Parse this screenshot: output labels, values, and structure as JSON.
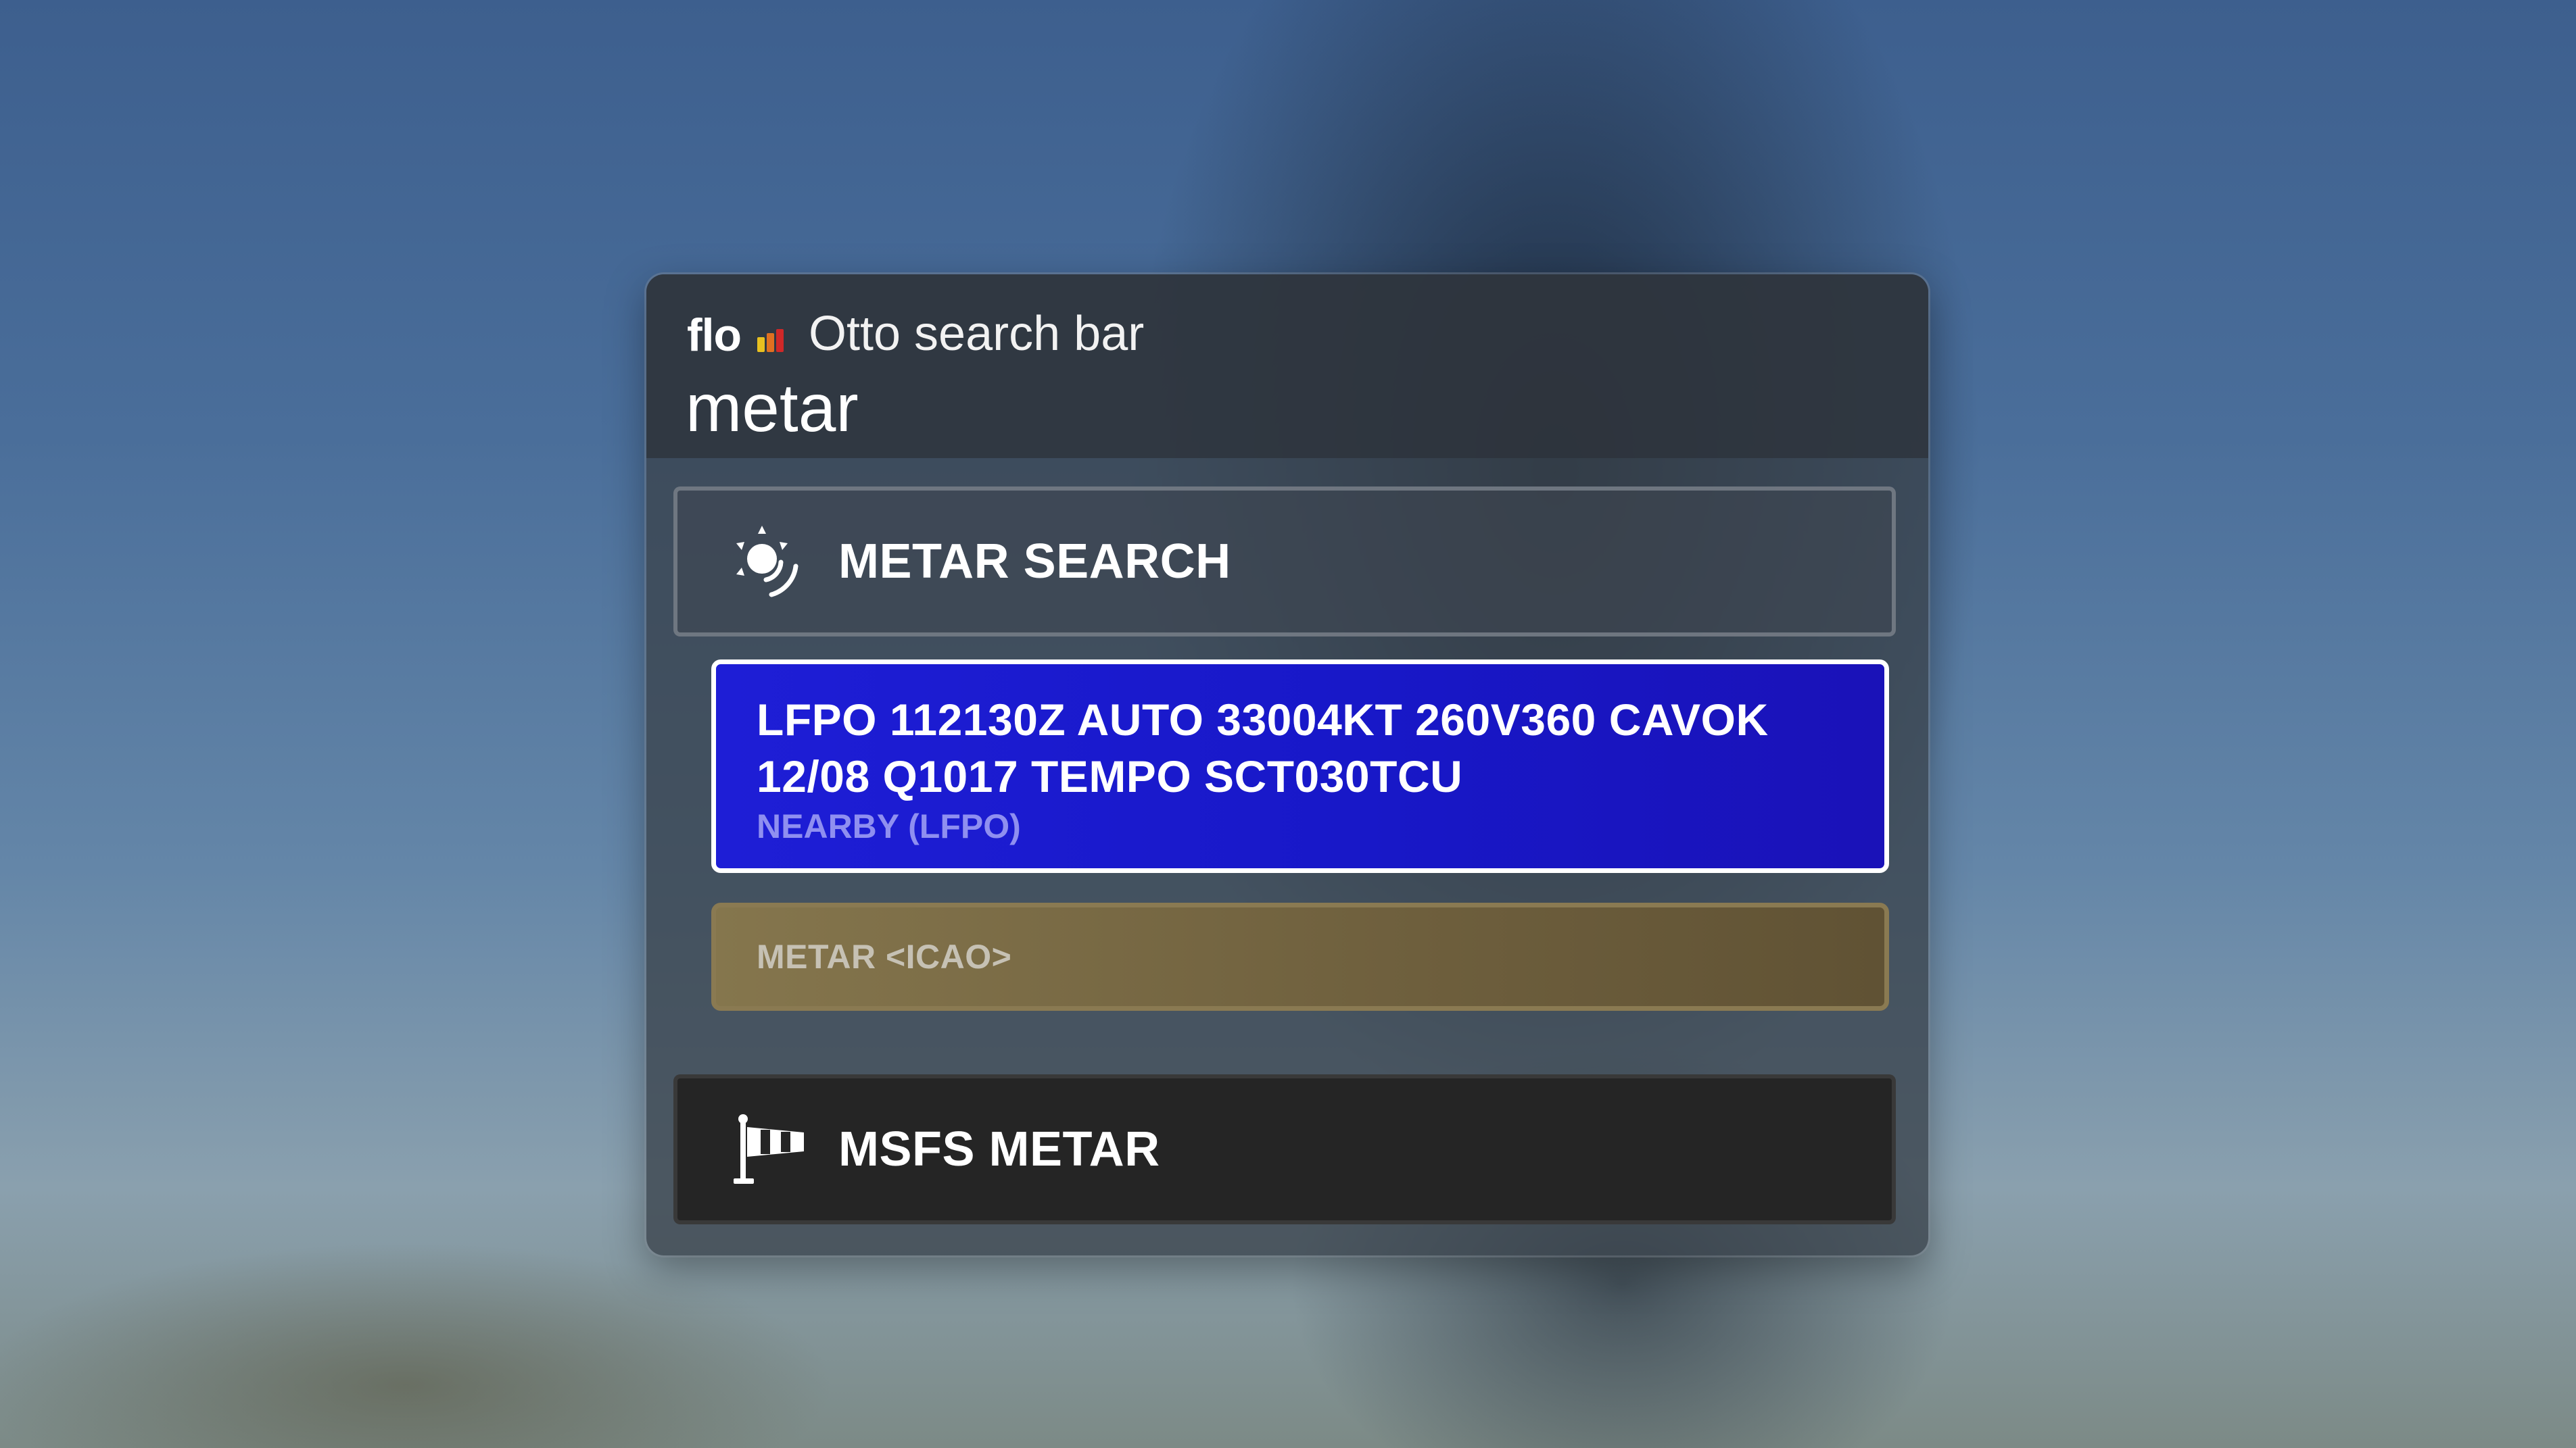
{
  "app": {
    "logo_text": "flow",
    "title": "Otto search bar"
  },
  "search": {
    "value": "metar"
  },
  "groups": [
    {
      "label": "METAR SEARCH",
      "icon": "weather-radar-icon"
    },
    {
      "label": "MSFS METAR",
      "icon": "windsock-icon"
    }
  ],
  "results": {
    "selected": {
      "line1": "LFPO 112130Z AUTO 33004KT 260V360 CAVOK",
      "line2": "12/08 Q1017 TEMPO SCT030TCU",
      "subtitle": "NEARBY (LFPO)"
    },
    "hint": {
      "label": "METAR <ICAO>"
    }
  },
  "colors": {
    "selected_bg": "#1e1ed6",
    "hint_bg": "#85764d",
    "logo_bars": [
      "#e8c020",
      "#e07020",
      "#d02828"
    ]
  }
}
